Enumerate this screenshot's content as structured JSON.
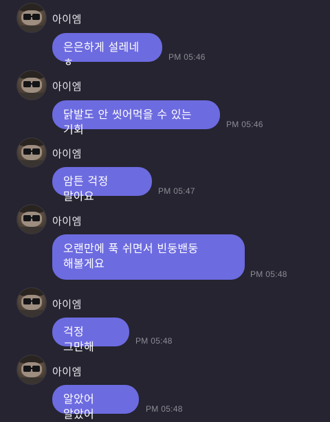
{
  "messages": [
    {
      "sender": "아이엠",
      "text": "은은하게 설레네 ㅎ",
      "time": "PM 05:46"
    },
    {
      "sender": "아이엠",
      "text": "닭발도 안 씻어먹을 수 있는 기회",
      "time": "PM 05:46"
    },
    {
      "sender": "아이엠",
      "text": "암튼 걱정 말아요",
      "time": "PM 05:47"
    },
    {
      "sender": "아이엠",
      "text": "오랜만에 푹 쉬면서 빈둥밴둥 해볼게요",
      "time": "PM 05:48"
    },
    {
      "sender": "아이엠",
      "text": "걱정 그만해",
      "time": "PM 05:48"
    },
    {
      "sender": "아이엠",
      "text": "알았어 알았어",
      "time": "PM 05:48"
    }
  ],
  "colors": {
    "background": "#252430",
    "bubble": "#6d6be0",
    "bubble_text": "#ffffff",
    "name_text": "#e8e8ee",
    "time_text": "#8c8c96"
  },
  "icons": {
    "avatar": "profile-photo"
  }
}
